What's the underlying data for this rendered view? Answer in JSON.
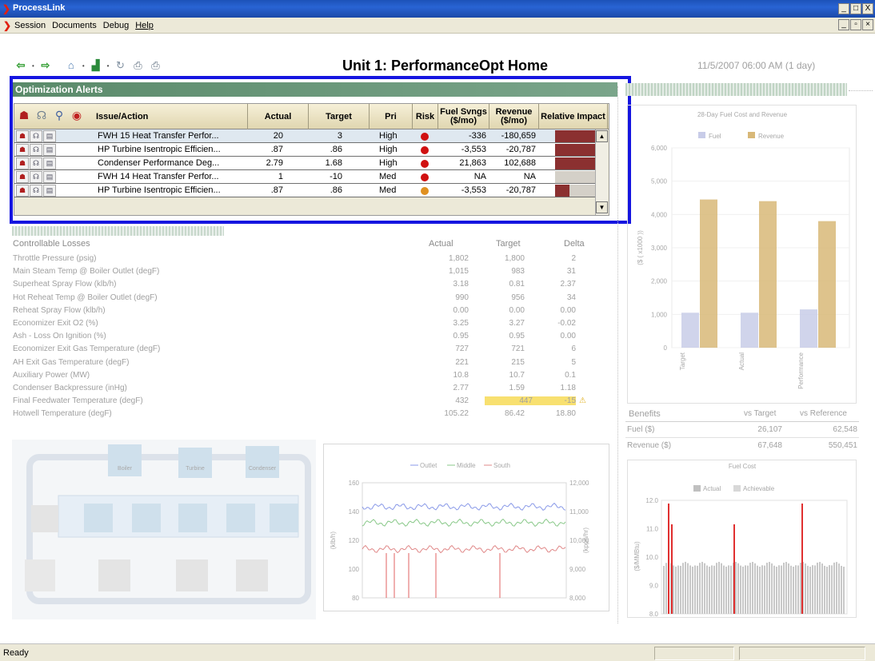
{
  "window": {
    "title": "ProcessLink",
    "min_label": "_",
    "restore_label": "□",
    "close_label": "X"
  },
  "menu": {
    "items": [
      "Session",
      "Documents",
      "Debug",
      "Help"
    ],
    "doc_min": "_",
    "doc_restore": "▫",
    "doc_close": "×"
  },
  "toolbar": {
    "back_icon": "back-arrow-icon",
    "forward_icon": "forward-arrow-icon"
  },
  "page": {
    "title": "Unit 1: PerformanceOpt Home",
    "datetime": "11/5/2007 06:00 AM (1 day)"
  },
  "alerts": {
    "header": "Optimization Alerts",
    "columns": {
      "issue": "Issue/Action",
      "actual": "Actual",
      "target": "Target",
      "pri": "Pri",
      "risk": "Risk",
      "fuel": "Fuel Svngs ($/mo)",
      "revenue": "Revenue ($/mo)",
      "impact": "Relative Impact"
    },
    "rows": [
      {
        "issue": "FWH 15 Heat Transfer Perfor...",
        "actual": "20",
        "target": "3",
        "pri": "High",
        "risk_color": "#d01010",
        "fuel": "-336",
        "revenue": "-180,659",
        "impact": 1.0
      },
      {
        "issue": "HP Turbine Isentropic Efficien...",
        "actual": ".87",
        "target": ".86",
        "pri": "High",
        "risk_color": "#d01010",
        "fuel": "-3,553",
        "revenue": "-20,787",
        "impact": 1.0
      },
      {
        "issue": "Condenser Performance Deg...",
        "actual": "2.79",
        "target": "1.68",
        "pri": "High",
        "risk_color": "#d01010",
        "fuel": "21,863",
        "revenue": "102,688",
        "impact": 1.0
      },
      {
        "issue": "FWH 14 Heat Transfer Perfor...",
        "actual": "1",
        "target": "-10",
        "pri": "Med",
        "risk_color": "#d01010",
        "fuel": "NA",
        "revenue": "NA",
        "impact": 0.0
      },
      {
        "issue": "HP Turbine Isentropic Efficien...",
        "actual": ".87",
        "target": ".86",
        "pri": "Med",
        "risk_color": "#e09020",
        "fuel": "-3,553",
        "revenue": "-20,787",
        "impact": 0.35
      }
    ]
  },
  "losses": {
    "title": "Controllable Losses",
    "col_actual": "Actual",
    "col_target": "Target",
    "col_delta": "Delta",
    "rows": [
      {
        "label": "Throttle Pressure (psig)",
        "actual": "1,802",
        "target": "1,800",
        "delta": "2"
      },
      {
        "label": "Main Steam Temp @ Boiler Outlet (degF)",
        "actual": "1,015",
        "target": "983",
        "delta": "31"
      },
      {
        "label": "Superheat Spray Flow (klb/h)",
        "actual": "3.18",
        "target": "0.81",
        "delta": "2.37"
      },
      {
        "label": "Hot Reheat Temp @ Boiler Outlet (degF)",
        "actual": "990",
        "target": "956",
        "delta": "34"
      },
      {
        "label": "Reheat Spray Flow (klb/h)",
        "actual": "0.00",
        "target": "0.00",
        "delta": "0.00"
      },
      {
        "label": "Economizer Exit O2 (%)",
        "actual": "3.25",
        "target": "3.27",
        "delta": "-0.02"
      },
      {
        "label": "Ash - Loss On Ignition (%)",
        "actual": "0.95",
        "target": "0.95",
        "delta": "0.00"
      },
      {
        "label": "Economizer Exit Gas Temperature (degF)",
        "actual": "727",
        "target": "721",
        "delta": "6"
      },
      {
        "label": "AH Exit Gas Temperature (degF)",
        "actual": "221",
        "target": "215",
        "delta": "5"
      },
      {
        "label": "Auxiliary Power (MW)",
        "actual": "10.8",
        "target": "10.7",
        "delta": "0.1"
      },
      {
        "label": "Condenser Backpressure (inHg)",
        "actual": "2.77",
        "target": "1.59",
        "delta": "1.18"
      },
      {
        "label": "Final Feedwater Temperature (degF)",
        "actual": "432",
        "target": "447",
        "delta": "-15"
      },
      {
        "label": "Hotwell Temperature (degF)",
        "actual": "105.22",
        "target": "86.42",
        "delta": "18.80"
      }
    ]
  },
  "benefits": {
    "title": "Benefits",
    "col_target": "vs Target",
    "col_reference": "vs Reference",
    "rows": [
      {
        "label": "Fuel ($)",
        "target": "26,107",
        "reference": "62,548"
      },
      {
        "label": "Revenue ($)",
        "target": "67,648",
        "reference": "550,451"
      }
    ]
  },
  "chart_data": [
    {
      "type": "bar",
      "title": "28-Day Fuel Cost and Revenue",
      "ylabel": "($ ( x1000 ))",
      "categories": [
        "Target",
        "Actual",
        "Performance"
      ],
      "series": [
        {
          "name": "Fuel",
          "values": [
            1050,
            1050,
            1150
          ],
          "color": "#c8cce8"
        },
        {
          "name": "Revenue",
          "values": [
            4450,
            4400,
            3800
          ],
          "color": "#d8b878"
        }
      ],
      "yticks": [
        "0",
        "1,000",
        "2,000",
        "3,000",
        "4,000",
        "5,000",
        "6,000"
      ],
      "ylim": [
        0,
        6000
      ]
    },
    {
      "type": "line",
      "legend": [
        "Outlet",
        "Middle",
        "South"
      ],
      "ylabel_left": "(klb/h)",
      "ylabel_right": "(kpph/hr)",
      "yticks_left": [
        "80",
        "100",
        "120",
        "140",
        "160"
      ],
      "yticks_right": [
        "8,000",
        "9,000",
        "10,000",
        "11,000",
        "12,000"
      ]
    },
    {
      "type": "bar",
      "title": "Fuel Cost",
      "legend": [
        "Actual",
        "Achievable"
      ],
      "ylabel": "($/MMBtu)",
      "yticks": [
        "8.0",
        "9.0",
        "10.0",
        "11.0",
        "12.0"
      ]
    }
  ],
  "diagram": {
    "boiler": "Boiler",
    "turbine": "Turbine",
    "condenser": "Condenser"
  },
  "status": {
    "text": "Ready"
  }
}
